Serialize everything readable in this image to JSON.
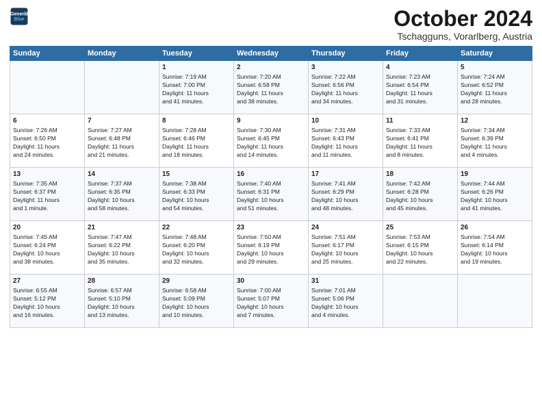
{
  "logo": {
    "line1": "General",
    "line2": "Blue"
  },
  "title": "October 2024",
  "subtitle": "Tschagguns, Vorarlberg, Austria",
  "days_header": [
    "Sunday",
    "Monday",
    "Tuesday",
    "Wednesday",
    "Thursday",
    "Friday",
    "Saturday"
  ],
  "weeks": [
    [
      {
        "day": "",
        "content": ""
      },
      {
        "day": "",
        "content": ""
      },
      {
        "day": "1",
        "content": "Sunrise: 7:19 AM\nSunset: 7:00 PM\nDaylight: 11 hours\nand 41 minutes."
      },
      {
        "day": "2",
        "content": "Sunrise: 7:20 AM\nSunset: 6:58 PM\nDaylight: 11 hours\nand 38 minutes."
      },
      {
        "day": "3",
        "content": "Sunrise: 7:22 AM\nSunset: 6:56 PM\nDaylight: 11 hours\nand 34 minutes."
      },
      {
        "day": "4",
        "content": "Sunrise: 7:23 AM\nSunset: 6:54 PM\nDaylight: 11 hours\nand 31 minutes."
      },
      {
        "day": "5",
        "content": "Sunrise: 7:24 AM\nSunset: 6:52 PM\nDaylight: 11 hours\nand 28 minutes."
      }
    ],
    [
      {
        "day": "6",
        "content": "Sunrise: 7:26 AM\nSunset: 6:50 PM\nDaylight: 11 hours\nand 24 minutes."
      },
      {
        "day": "7",
        "content": "Sunrise: 7:27 AM\nSunset: 6:48 PM\nDaylight: 11 hours\nand 21 minutes."
      },
      {
        "day": "8",
        "content": "Sunrise: 7:28 AM\nSunset: 6:46 PM\nDaylight: 11 hours\nand 18 minutes."
      },
      {
        "day": "9",
        "content": "Sunrise: 7:30 AM\nSunset: 6:45 PM\nDaylight: 11 hours\nand 14 minutes."
      },
      {
        "day": "10",
        "content": "Sunrise: 7:31 AM\nSunset: 6:43 PM\nDaylight: 11 hours\nand 11 minutes."
      },
      {
        "day": "11",
        "content": "Sunrise: 7:33 AM\nSunset: 6:41 PM\nDaylight: 11 hours\nand 8 minutes."
      },
      {
        "day": "12",
        "content": "Sunrise: 7:34 AM\nSunset: 6:39 PM\nDaylight: 11 hours\nand 4 minutes."
      }
    ],
    [
      {
        "day": "13",
        "content": "Sunrise: 7:35 AM\nSunset: 6:37 PM\nDaylight: 11 hours\nand 1 minute."
      },
      {
        "day": "14",
        "content": "Sunrise: 7:37 AM\nSunset: 6:35 PM\nDaylight: 10 hours\nand 58 minutes."
      },
      {
        "day": "15",
        "content": "Sunrise: 7:38 AM\nSunset: 6:33 PM\nDaylight: 10 hours\nand 54 minutes."
      },
      {
        "day": "16",
        "content": "Sunrise: 7:40 AM\nSunset: 6:31 PM\nDaylight: 10 hours\nand 51 minutes."
      },
      {
        "day": "17",
        "content": "Sunrise: 7:41 AM\nSunset: 6:29 PM\nDaylight: 10 hours\nand 48 minutes."
      },
      {
        "day": "18",
        "content": "Sunrise: 7:42 AM\nSunset: 6:28 PM\nDaylight: 10 hours\nand 45 minutes."
      },
      {
        "day": "19",
        "content": "Sunrise: 7:44 AM\nSunset: 6:26 PM\nDaylight: 10 hours\nand 41 minutes."
      }
    ],
    [
      {
        "day": "20",
        "content": "Sunrise: 7:45 AM\nSunset: 6:24 PM\nDaylight: 10 hours\nand 38 minutes."
      },
      {
        "day": "21",
        "content": "Sunrise: 7:47 AM\nSunset: 6:22 PM\nDaylight: 10 hours\nand 35 minutes."
      },
      {
        "day": "22",
        "content": "Sunrise: 7:48 AM\nSunset: 6:20 PM\nDaylight: 10 hours\nand 32 minutes."
      },
      {
        "day": "23",
        "content": "Sunrise: 7:50 AM\nSunset: 6:19 PM\nDaylight: 10 hours\nand 29 minutes."
      },
      {
        "day": "24",
        "content": "Sunrise: 7:51 AM\nSunset: 6:17 PM\nDaylight: 10 hours\nand 25 minutes."
      },
      {
        "day": "25",
        "content": "Sunrise: 7:53 AM\nSunset: 6:15 PM\nDaylight: 10 hours\nand 22 minutes."
      },
      {
        "day": "26",
        "content": "Sunrise: 7:54 AM\nSunset: 6:14 PM\nDaylight: 10 hours\nand 19 minutes."
      }
    ],
    [
      {
        "day": "27",
        "content": "Sunrise: 6:55 AM\nSunset: 5:12 PM\nDaylight: 10 hours\nand 16 minutes."
      },
      {
        "day": "28",
        "content": "Sunrise: 6:57 AM\nSunset: 5:10 PM\nDaylight: 10 hours\nand 13 minutes."
      },
      {
        "day": "29",
        "content": "Sunrise: 6:58 AM\nSunset: 5:09 PM\nDaylight: 10 hours\nand 10 minutes."
      },
      {
        "day": "30",
        "content": "Sunrise: 7:00 AM\nSunset: 5:07 PM\nDaylight: 10 hours\nand 7 minutes."
      },
      {
        "day": "31",
        "content": "Sunrise: 7:01 AM\nSunset: 5:06 PM\nDaylight: 10 hours\nand 4 minutes."
      },
      {
        "day": "",
        "content": ""
      },
      {
        "day": "",
        "content": ""
      }
    ]
  ]
}
